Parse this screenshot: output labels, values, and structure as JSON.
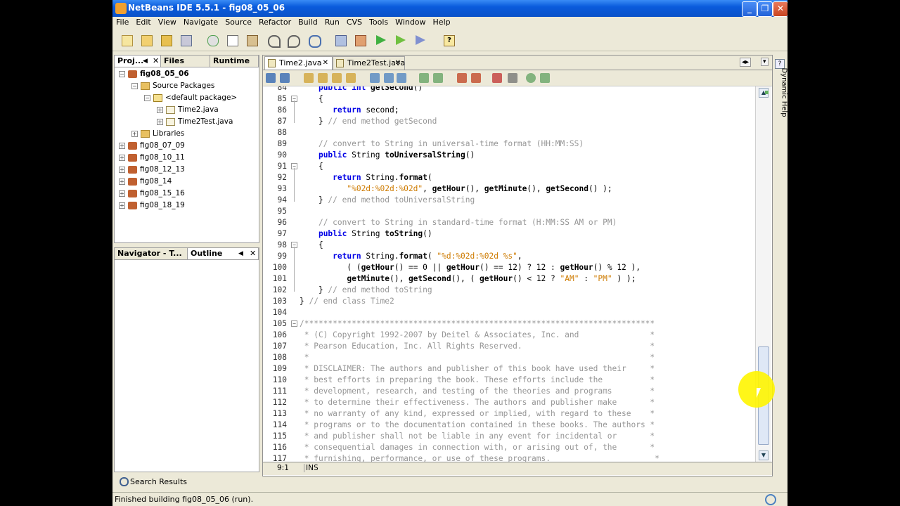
{
  "window": {
    "title": "NetBeans IDE 5.5.1 - fig08_05_06"
  },
  "menu": [
    "File",
    "Edit",
    "View",
    "Navigate",
    "Source",
    "Refactor",
    "Build",
    "Run",
    "CVS",
    "Tools",
    "Window",
    "Help"
  ],
  "projects_pane": {
    "tabs": [
      "Proj...",
      "Files",
      "Runtime"
    ],
    "tree": [
      {
        "label": "fig08_05_06",
        "level": 0,
        "exp": "−",
        "icon": "proj",
        "bold": true
      },
      {
        "label": "Source Packages",
        "level": 1,
        "exp": "−",
        "icon": "pkgf"
      },
      {
        "label": "<default package>",
        "level": 2,
        "exp": "−",
        "icon": "pkg"
      },
      {
        "label": "Time2.java",
        "level": 3,
        "exp": "+",
        "icon": "java"
      },
      {
        "label": "Time2Test.java",
        "level": 3,
        "exp": "+",
        "icon": "java"
      },
      {
        "label": "Libraries",
        "level": 1,
        "exp": "+",
        "icon": "pkgf"
      },
      {
        "label": "fig08_07_09",
        "level": 0,
        "exp": "+",
        "icon": "proj"
      },
      {
        "label": "fig08_10_11",
        "level": 0,
        "exp": "+",
        "icon": "proj"
      },
      {
        "label": "fig08_12_13",
        "level": 0,
        "exp": "+",
        "icon": "proj"
      },
      {
        "label": "fig08_14",
        "level": 0,
        "exp": "+",
        "icon": "proj"
      },
      {
        "label": "fig08_15_16",
        "level": 0,
        "exp": "+",
        "icon": "proj"
      },
      {
        "label": "fig08_18_19",
        "level": 0,
        "exp": "+",
        "icon": "proj"
      }
    ]
  },
  "navigator_pane": {
    "tabs": [
      "Navigator - T...",
      "Outline"
    ]
  },
  "editor": {
    "tabs": [
      "Time2.java",
      "Time2Test.java"
    ],
    "lines": [
      {
        "n": "84",
        "seg": [
          [
            "    ",
            ""
          ],
          [
            "public int ",
            "kw"
          ],
          [
            "getSecond",
            "fn"
          ],
          [
            "()",
            ""
          ]
        ]
      },
      {
        "n": "85",
        "seg": [
          [
            "    {",
            ""
          ]
        ],
        "fold": "−"
      },
      {
        "n": "86",
        "seg": [
          [
            "       ",
            ""
          ],
          [
            "return ",
            "kw"
          ],
          [
            "second;",
            ""
          ]
        ]
      },
      {
        "n": "87",
        "seg": [
          [
            "    } ",
            ""
          ],
          [
            "// end method getSecond",
            "cm"
          ]
        ]
      },
      {
        "n": "88",
        "seg": []
      },
      {
        "n": "89",
        "seg": [
          [
            "    ",
            ""
          ],
          [
            "// convert to String in universal-time format (HH:MM:SS)",
            "cm"
          ]
        ]
      },
      {
        "n": "90",
        "seg": [
          [
            "    ",
            ""
          ],
          [
            "public ",
            "kw"
          ],
          [
            "String ",
            ""
          ],
          [
            "toUniversalString",
            "fn"
          ],
          [
            "()",
            ""
          ]
        ]
      },
      {
        "n": "91",
        "seg": [
          [
            "    {",
            ""
          ]
        ],
        "fold": "−"
      },
      {
        "n": "92",
        "seg": [
          [
            "       ",
            ""
          ],
          [
            "return ",
            "kw"
          ],
          [
            "String.",
            ""
          ],
          [
            "format",
            "fn"
          ],
          [
            "(",
            ""
          ]
        ]
      },
      {
        "n": "93",
        "seg": [
          [
            "          ",
            ""
          ],
          [
            "\"%02d:%02d:%02d\"",
            "st"
          ],
          [
            ", ",
            ""
          ],
          [
            "getHour",
            "fn"
          ],
          [
            "(), ",
            ""
          ],
          [
            "getMinute",
            "fn"
          ],
          [
            "(), ",
            ""
          ],
          [
            "getSecond",
            "fn"
          ],
          [
            "() );",
            ""
          ]
        ]
      },
      {
        "n": "94",
        "seg": [
          [
            "    } ",
            ""
          ],
          [
            "// end method toUniversalString",
            "cm"
          ]
        ]
      },
      {
        "n": "95",
        "seg": []
      },
      {
        "n": "96",
        "seg": [
          [
            "    ",
            ""
          ],
          [
            "// convert to String in standard-time format (H:MM:SS AM or PM)",
            "cm"
          ]
        ]
      },
      {
        "n": "97",
        "seg": [
          [
            "    ",
            ""
          ],
          [
            "public ",
            "kw"
          ],
          [
            "String ",
            ""
          ],
          [
            "toString",
            "fn"
          ],
          [
            "()",
            ""
          ]
        ]
      },
      {
        "n": "98",
        "seg": [
          [
            "    {",
            ""
          ]
        ],
        "fold": "−"
      },
      {
        "n": "99",
        "seg": [
          [
            "       ",
            ""
          ],
          [
            "return ",
            "kw"
          ],
          [
            "String.",
            ""
          ],
          [
            "format",
            "fn"
          ],
          [
            "( ",
            ""
          ],
          [
            "\"%d:%02d:%02d %s\"",
            "st"
          ],
          [
            ",",
            ""
          ]
        ]
      },
      {
        "n": "100",
        "seg": [
          [
            "          ( (",
            ""
          ],
          [
            "getHour",
            "fn"
          ],
          [
            "() == 0 || ",
            ""
          ],
          [
            "getHour",
            "fn"
          ],
          [
            "() == 12) ? 12 : ",
            ""
          ],
          [
            "getHour",
            "fn"
          ],
          [
            "() % 12 ),",
            ""
          ]
        ]
      },
      {
        "n": "101",
        "seg": [
          [
            "          ",
            ""
          ],
          [
            "getMinute",
            "fn"
          ],
          [
            "(), ",
            ""
          ],
          [
            "getSecond",
            "fn"
          ],
          [
            "(), ( ",
            ""
          ],
          [
            "getHour",
            "fn"
          ],
          [
            "() < 12 ? ",
            ""
          ],
          [
            "\"AM\"",
            "st"
          ],
          [
            " : ",
            ""
          ],
          [
            "\"PM\"",
            "st"
          ],
          [
            " ) );",
            ""
          ]
        ]
      },
      {
        "n": "102",
        "seg": [
          [
            "    } ",
            ""
          ],
          [
            "// end method toString",
            "cm"
          ]
        ]
      },
      {
        "n": "103",
        "seg": [
          [
            "} ",
            ""
          ],
          [
            "// end class Time2",
            "cm"
          ]
        ]
      },
      {
        "n": "104",
        "seg": []
      },
      {
        "n": "105",
        "seg": [
          [
            "/**************************************************************************",
            "cm"
          ]
        ],
        "fold": "−"
      },
      {
        "n": "106",
        "seg": [
          [
            " * (C) Copyright 1992-2007 by Deitel & Associates, Inc. and               *",
            "cm"
          ]
        ]
      },
      {
        "n": "107",
        "seg": [
          [
            " * Pearson Education, Inc. All Rights Reserved.                           *",
            "cm"
          ]
        ]
      },
      {
        "n": "108",
        "seg": [
          [
            " *                                                                        *",
            "cm"
          ]
        ]
      },
      {
        "n": "109",
        "seg": [
          [
            " * DISCLAIMER: The authors and publisher of this book have used their     *",
            "cm"
          ]
        ]
      },
      {
        "n": "110",
        "seg": [
          [
            " * best efforts in preparing the book. These efforts include the          *",
            "cm"
          ]
        ]
      },
      {
        "n": "111",
        "seg": [
          [
            " * development, research, and testing of the theories and programs        *",
            "cm"
          ]
        ]
      },
      {
        "n": "112",
        "seg": [
          [
            " * to determine their effectiveness. The authors and publisher make       *",
            "cm"
          ]
        ]
      },
      {
        "n": "113",
        "seg": [
          [
            " * no warranty of any kind, expressed or implied, with regard to these    *",
            "cm"
          ]
        ]
      },
      {
        "n": "114",
        "seg": [
          [
            " * programs or to the documentation contained in these books. The authors *",
            "cm"
          ]
        ]
      },
      {
        "n": "115",
        "seg": [
          [
            " * and publisher shall not be liable in any event for incidental or       *",
            "cm"
          ]
        ]
      },
      {
        "n": "116",
        "seg": [
          [
            " * consequential damages in connection with, or arising out of, the       *",
            "cm"
          ]
        ]
      },
      {
        "n": "117",
        "seg": [
          [
            " * furnishing, performance, or use of these programs.                      *",
            "cm"
          ]
        ]
      }
    ],
    "cursor_pos": "9:1",
    "mode": "INS"
  },
  "right_panel": {
    "label": "Dynamic Help"
  },
  "bottom": {
    "search_results": "Search Results"
  },
  "status": {
    "text": "Finished building fig08_05_06 (run)."
  }
}
